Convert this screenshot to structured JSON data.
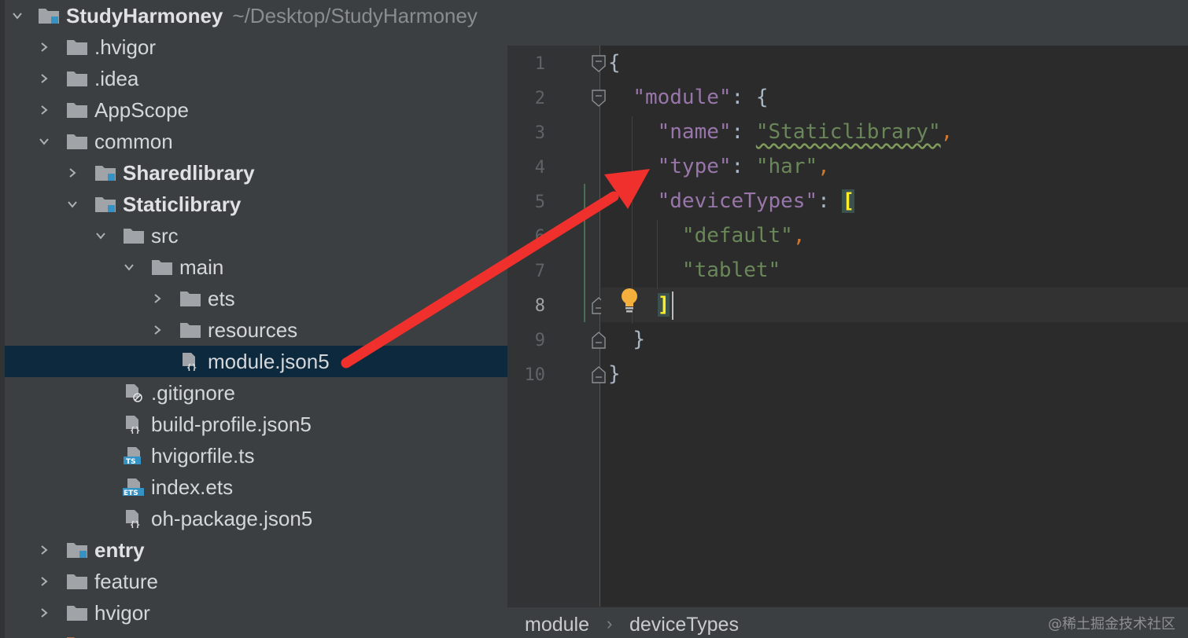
{
  "project": {
    "name": "StudyHarmoney",
    "path": "~/Desktop/StudyHarmoney"
  },
  "tree": [
    {
      "label": "StudyHarmoney",
      "type": "module",
      "expanded": true,
      "bold": true
    },
    {
      "label": ".hvigor",
      "type": "folder",
      "expanded": false
    },
    {
      "label": ".idea",
      "type": "folder",
      "expanded": false
    },
    {
      "label": "AppScope",
      "type": "folder",
      "expanded": false
    },
    {
      "label": "common",
      "type": "folder",
      "expanded": true
    },
    {
      "label": "Sharedlibrary",
      "type": "module",
      "expanded": false,
      "bold": true
    },
    {
      "label": "Staticlibrary",
      "type": "module",
      "expanded": true,
      "bold": true
    },
    {
      "label": "src",
      "type": "folder",
      "expanded": true
    },
    {
      "label": "main",
      "type": "folder",
      "expanded": true
    },
    {
      "label": "ets",
      "type": "folder",
      "expanded": false
    },
    {
      "label": "resources",
      "type": "folder",
      "expanded": false
    },
    {
      "label": "module.json5",
      "type": "json-file",
      "selected": true
    },
    {
      "label": ".gitignore",
      "type": "ignore-file"
    },
    {
      "label": "build-profile.json5",
      "type": "json-file"
    },
    {
      "label": "hvigorfile.ts",
      "type": "ts-file"
    },
    {
      "label": "index.ets",
      "type": "ets-file"
    },
    {
      "label": "oh-package.json5",
      "type": "json-file"
    },
    {
      "label": "entry",
      "type": "module",
      "expanded": false,
      "bold": true
    },
    {
      "label": "feature",
      "type": "folder",
      "expanded": false
    },
    {
      "label": "hvigor",
      "type": "folder",
      "expanded": false
    }
  ],
  "editor": {
    "current_line": 8,
    "line_numbers": [
      "1",
      "2",
      "3",
      "4",
      "5",
      "6",
      "7",
      "8",
      "9",
      "10"
    ],
    "lines": {
      "l1": {
        "p1": "{"
      },
      "l2": {
        "k": "\"module\"",
        "p1": ":",
        "p2": " {"
      },
      "l3": {
        "k": "\"name\"",
        "p1": ":",
        "v": "\"Staticlibrary\"",
        "p2": ","
      },
      "l4": {
        "k": "\"type\"",
        "p1": ":",
        "v": "\"har\"",
        "p2": ","
      },
      "l5": {
        "k": "\"deviceTypes\"",
        "p1": ":",
        "p2": "["
      },
      "l6": {
        "v": "\"default\"",
        "p2": ","
      },
      "l7": {
        "v": "\"tablet\""
      },
      "l8": {
        "p1": "]"
      },
      "l9": {
        "p1": "}"
      },
      "l10": {
        "p1": "}"
      }
    }
  },
  "breadcrumbs": [
    "module",
    "deviceTypes"
  ],
  "breadcrumb_separator": "›",
  "watermark": "@稀土掘金技术社区",
  "colors": {
    "annotation_arrow": "#f0302c",
    "selection": "#0d293e",
    "json_key": "#9876aa",
    "json_string": "#6a8759",
    "json_punctuation": "#cc7832"
  }
}
